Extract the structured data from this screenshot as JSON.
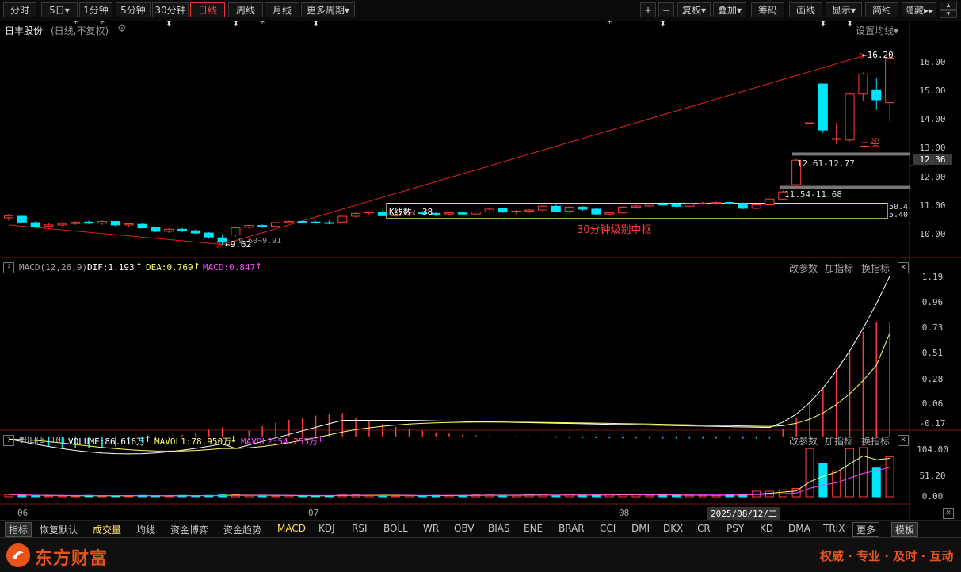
{
  "toolbar": {
    "left_buttons": [
      "分时",
      "5日▾",
      "1分钟",
      "5分钟",
      "30分钟",
      "日线",
      "周线",
      "月线",
      "更多周期▾"
    ],
    "active": "日线",
    "right_buttons": [
      "+",
      "−",
      "复权▾",
      "叠加▾",
      "筹码",
      "画线",
      "显示▾",
      "简约",
      "隐藏▸▸",
      "▴",
      "▾"
    ]
  },
  "stock": {
    "name": "日丰股份",
    "mode": "(日线,不复权)",
    "ma_setting": "设置均线▾"
  },
  "price_axis": {
    "labels": [
      "16.00",
      "15.00",
      "14.00",
      "13.00",
      "12.00",
      "11.00",
      "10.00"
    ],
    "current": "12.36"
  },
  "annotations": {
    "high_label": "←16.20",
    "low_label": "←9.62",
    "low_extra": "9.60~9.91",
    "san_mai": "三买",
    "zone_upper": "12.61-12.77",
    "zone_lower": "11.54-11.68",
    "k_count": "K线数: 38",
    "hub_label": "30分钟级别中枢",
    "hub_right_top": "50.4",
    "hub_right_bottom": "5.40"
  },
  "macd": {
    "name": "MACD(12,26,9)",
    "dif": "DIF:1.193",
    "dea": "DEA:0.769",
    "macd": "MACD:0.847",
    "axis": [
      "1.19",
      "0.96",
      "0.73",
      "0.51",
      "0.28",
      "0.06",
      "-0.17"
    ],
    "buttons": [
      "改参数",
      "加指标",
      "换指标"
    ]
  },
  "vol": {
    "name": "VOL(5,10)",
    "volume": "VOLUME:86.616万",
    "mavol1": "MAVOL1:78.950万",
    "mavol2": "MAVOL2:54.255万",
    "axis": [
      "104.00",
      "51.20",
      "0.00"
    ],
    "buttons": [
      "改参数",
      "加指标",
      "换指标"
    ]
  },
  "time_axis": {
    "m06": "06",
    "m07": "07",
    "m08": "08",
    "cursor_date": "2025/08/12/二"
  },
  "indicator_tabs": [
    "指标",
    "恢复默认",
    "成交量",
    "均线",
    "资金博弈",
    "资金趋势",
    "MACD",
    "KDJ",
    "RSI",
    "BOLL",
    "WR",
    "OBV",
    "BIAS",
    "ENE",
    "BRAR",
    "CCI",
    "DMI",
    "DKX",
    "CR",
    "PSY",
    "KD",
    "DMA",
    "TRIX",
    "更多",
    "模板"
  ],
  "footer": {
    "brand": "东方财富",
    "slogan": "权威 · 专业 · 及时 · 互动"
  },
  "colors": {
    "up": "#ff3c3c",
    "down": "#00e5ff",
    "dif": "#ffffff",
    "dea": "#ffff66",
    "macd": "#ff44ff",
    "background": "#000000"
  },
  "chart_data": {
    "type": "candlestick",
    "days": [
      [
        10.55,
        10.68,
        10.45,
        10.62
      ],
      [
        10.6,
        10.62,
        10.35,
        10.4
      ],
      [
        10.38,
        10.42,
        10.2,
        10.25
      ],
      [
        10.25,
        10.35,
        10.2,
        10.3
      ],
      [
        10.3,
        10.4,
        10.25,
        10.35
      ],
      [
        10.35,
        10.42,
        10.3,
        10.4
      ],
      [
        10.4,
        10.45,
        10.33,
        10.36
      ],
      [
        10.36,
        10.45,
        10.3,
        10.42
      ],
      [
        10.42,
        10.45,
        10.25,
        10.3
      ],
      [
        10.3,
        10.36,
        10.22,
        10.34
      ],
      [
        10.32,
        10.35,
        10.18,
        10.2
      ],
      [
        10.2,
        10.22,
        10.05,
        10.08
      ],
      [
        10.08,
        10.18,
        10.02,
        10.15
      ],
      [
        10.15,
        10.2,
        10.05,
        10.1
      ],
      [
        10.1,
        10.15,
        9.98,
        10.02
      ],
      [
        10.02,
        10.05,
        9.82,
        9.88
      ],
      [
        9.85,
        9.95,
        9.62,
        9.7
      ],
      [
        9.95,
        10.25,
        9.9,
        10.2
      ],
      [
        10.22,
        10.3,
        10.18,
        10.28
      ],
      [
        10.28,
        10.32,
        10.2,
        10.25
      ],
      [
        10.25,
        10.4,
        10.22,
        10.38
      ],
      [
        10.38,
        10.45,
        10.35,
        10.42
      ],
      [
        10.42,
        10.45,
        10.36,
        10.4
      ],
      [
        10.4,
        10.44,
        10.35,
        10.38
      ],
      [
        10.38,
        10.45,
        10.32,
        10.36
      ],
      [
        10.4,
        10.62,
        10.38,
        10.6
      ],
      [
        10.6,
        10.75,
        10.55,
        10.7
      ],
      [
        10.72,
        10.78,
        10.65,
        10.75
      ],
      [
        10.75,
        10.8,
        10.6,
        10.62
      ],
      [
        10.62,
        10.7,
        10.58,
        10.65
      ],
      [
        10.65,
        10.75,
        10.6,
        10.72
      ],
      [
        10.72,
        10.78,
        10.68,
        10.7
      ],
      [
        10.7,
        10.75,
        10.6,
        10.68
      ],
      [
        10.68,
        10.74,
        10.65,
        10.72
      ],
      [
        10.72,
        10.75,
        10.65,
        10.68
      ],
      [
        10.68,
        10.78,
        10.66,
        10.75
      ],
      [
        10.75,
        10.88,
        10.72,
        10.85
      ],
      [
        10.88,
        10.9,
        10.72,
        10.75
      ],
      [
        10.75,
        10.82,
        10.68,
        10.78
      ],
      [
        10.78,
        10.85,
        10.72,
        10.82
      ],
      [
        10.82,
        10.98,
        10.78,
        10.95
      ],
      [
        10.95,
        11.0,
        10.75,
        10.78
      ],
      [
        10.78,
        10.95,
        10.72,
        10.92
      ],
      [
        10.92,
        10.95,
        10.8,
        10.85
      ],
      [
        10.85,
        10.9,
        10.65,
        10.68
      ],
      [
        10.68,
        10.75,
        10.62,
        10.72
      ],
      [
        10.72,
        10.95,
        10.7,
        10.92
      ],
      [
        10.92,
        11.0,
        10.88,
        10.96
      ],
      [
        10.96,
        11.05,
        10.92,
        11.02
      ],
      [
        11.02,
        11.08,
        10.98,
        11.0
      ],
      [
        11.0,
        11.05,
        10.92,
        10.95
      ],
      [
        10.95,
        11.06,
        10.92,
        11.04
      ],
      [
        11.04,
        11.1,
        11.0,
        11.06
      ],
      [
        11.06,
        11.12,
        11.02,
        11.08
      ],
      [
        11.08,
        11.12,
        11.0,
        11.04
      ],
      [
        11.04,
        11.08,
        10.85,
        10.88
      ],
      [
        10.88,
        11.02,
        10.85,
        11.0
      ],
      [
        11.0,
        11.22,
        10.98,
        11.2
      ],
      [
        11.2,
        11.5,
        11.15,
        11.45
      ],
      [
        11.7,
        12.6,
        11.6,
        12.55
      ],
      [
        13.85,
        13.85,
        13.8,
        13.85
      ],
      [
        15.2,
        15.2,
        13.5,
        13.6
      ],
      [
        13.3,
        13.85,
        13.1,
        13.3
      ],
      [
        13.25,
        14.9,
        13.2,
        14.85
      ],
      [
        14.85,
        15.6,
        14.6,
        15.55
      ],
      [
        15.0,
        15.4,
        14.3,
        14.65
      ],
      [
        14.55,
        16.2,
        13.9,
        16.1
      ]
    ],
    "volumes": [
      5,
      3,
      2,
      2,
      2,
      2,
      3,
      2,
      2,
      2,
      3,
      2,
      2,
      3,
      2,
      3,
      4,
      5,
      3,
      2,
      2,
      3,
      2,
      2,
      2,
      5,
      4,
      3,
      3,
      2,
      3,
      2,
      3,
      3,
      3,
      4,
      4,
      3,
      3,
      5,
      4,
      3,
      4,
      3,
      4,
      6,
      5,
      4,
      3,
      4,
      4,
      3,
      3,
      3,
      5,
      6,
      12,
      12,
      15,
      18,
      104,
      72,
      56,
      104,
      106,
      62,
      86.6
    ],
    "points": {
      "low": 9.62,
      "high": 16.2
    },
    "hub": {
      "upper": 11.05,
      "lower": 10.52
    },
    "macd_hist_range": [
      -0.17,
      0.85
    ],
    "months": [
      "06",
      "07",
      "08"
    ]
  }
}
